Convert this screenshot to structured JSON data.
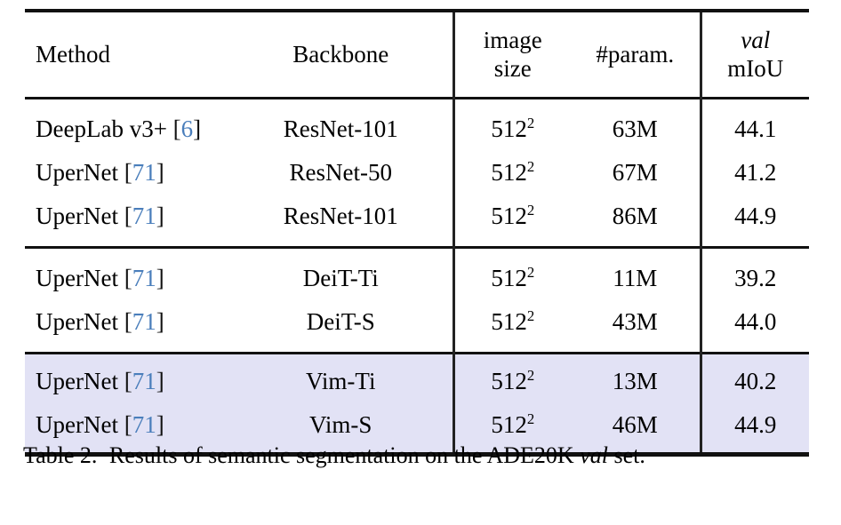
{
  "document": {
    "type": "paper-table-figure",
    "background_color": "#ffffff",
    "text_color": "#000000",
    "citation_color": "#4a7ebb",
    "highlight_color": "#e2e2f5",
    "rule_color": "#111111"
  },
  "table": {
    "columns": [
      {
        "key": "method",
        "label": "Method",
        "align": "left",
        "italic_part": ""
      },
      {
        "key": "backbone",
        "label": "Backbone",
        "align": "center",
        "italic_part": ""
      },
      {
        "key": "size",
        "label_line1": "image",
        "label_line2": "size",
        "align": "center"
      },
      {
        "key": "param",
        "label": "#param.",
        "align": "center"
      },
      {
        "key": "miou",
        "label_line1": "val",
        "label_line2": "mIoU",
        "align": "center",
        "line1_italic": true
      }
    ],
    "groups": [
      {
        "id": "cnn-group",
        "highlighted": false,
        "rows": [
          {
            "method_text": "DeepLab v3+",
            "citation_open": "[",
            "citation_num": "6",
            "citation_close": "]",
            "backbone": "ResNet-101",
            "size_base": "512",
            "size_exp": "2",
            "param": "63M",
            "miou": "44.1"
          },
          {
            "method_text": "UperNet",
            "citation_open": "[",
            "citation_num": "71",
            "citation_close": "]",
            "backbone": "ResNet-50",
            "size_base": "512",
            "size_exp": "2",
            "param": "67M",
            "miou": "41.2"
          },
          {
            "method_text": "UperNet",
            "citation_open": "[",
            "citation_num": "71",
            "citation_close": "]",
            "backbone": "ResNet-101",
            "size_base": "512",
            "size_exp": "2",
            "param": "86M",
            "miou": "44.9"
          }
        ]
      },
      {
        "id": "deit-group",
        "highlighted": false,
        "rows": [
          {
            "method_text": "UperNet",
            "citation_open": "[",
            "citation_num": "71",
            "citation_close": "]",
            "backbone": "DeiT-Ti",
            "size_base": "512",
            "size_exp": "2",
            "param": "11M",
            "miou": "39.2"
          },
          {
            "method_text": "UperNet",
            "citation_open": "[",
            "citation_num": "71",
            "citation_close": "]",
            "backbone": "DeiT-S",
            "size_base": "512",
            "size_exp": "2",
            "param": "43M",
            "miou": "44.0"
          }
        ]
      },
      {
        "id": "vim-group",
        "highlighted": true,
        "rows": [
          {
            "method_text": "UperNet",
            "citation_open": "[",
            "citation_num": "71",
            "citation_close": "]",
            "backbone": "Vim-Ti",
            "size_base": "512",
            "size_exp": "2",
            "param": "13M",
            "miou": "40.2"
          },
          {
            "method_text": "UperNet",
            "citation_open": "[",
            "citation_num": "71",
            "citation_close": "]",
            "backbone": "Vim-S",
            "size_base": "512",
            "size_exp": "2",
            "param": "46M",
            "miou": "44.9"
          }
        ]
      }
    ]
  },
  "caption": {
    "label": "Table 2.",
    "text_before_italic": "Results of semantic segmentation on the ADE20K",
    "italic_word": "val",
    "text_after_italic": "set."
  }
}
